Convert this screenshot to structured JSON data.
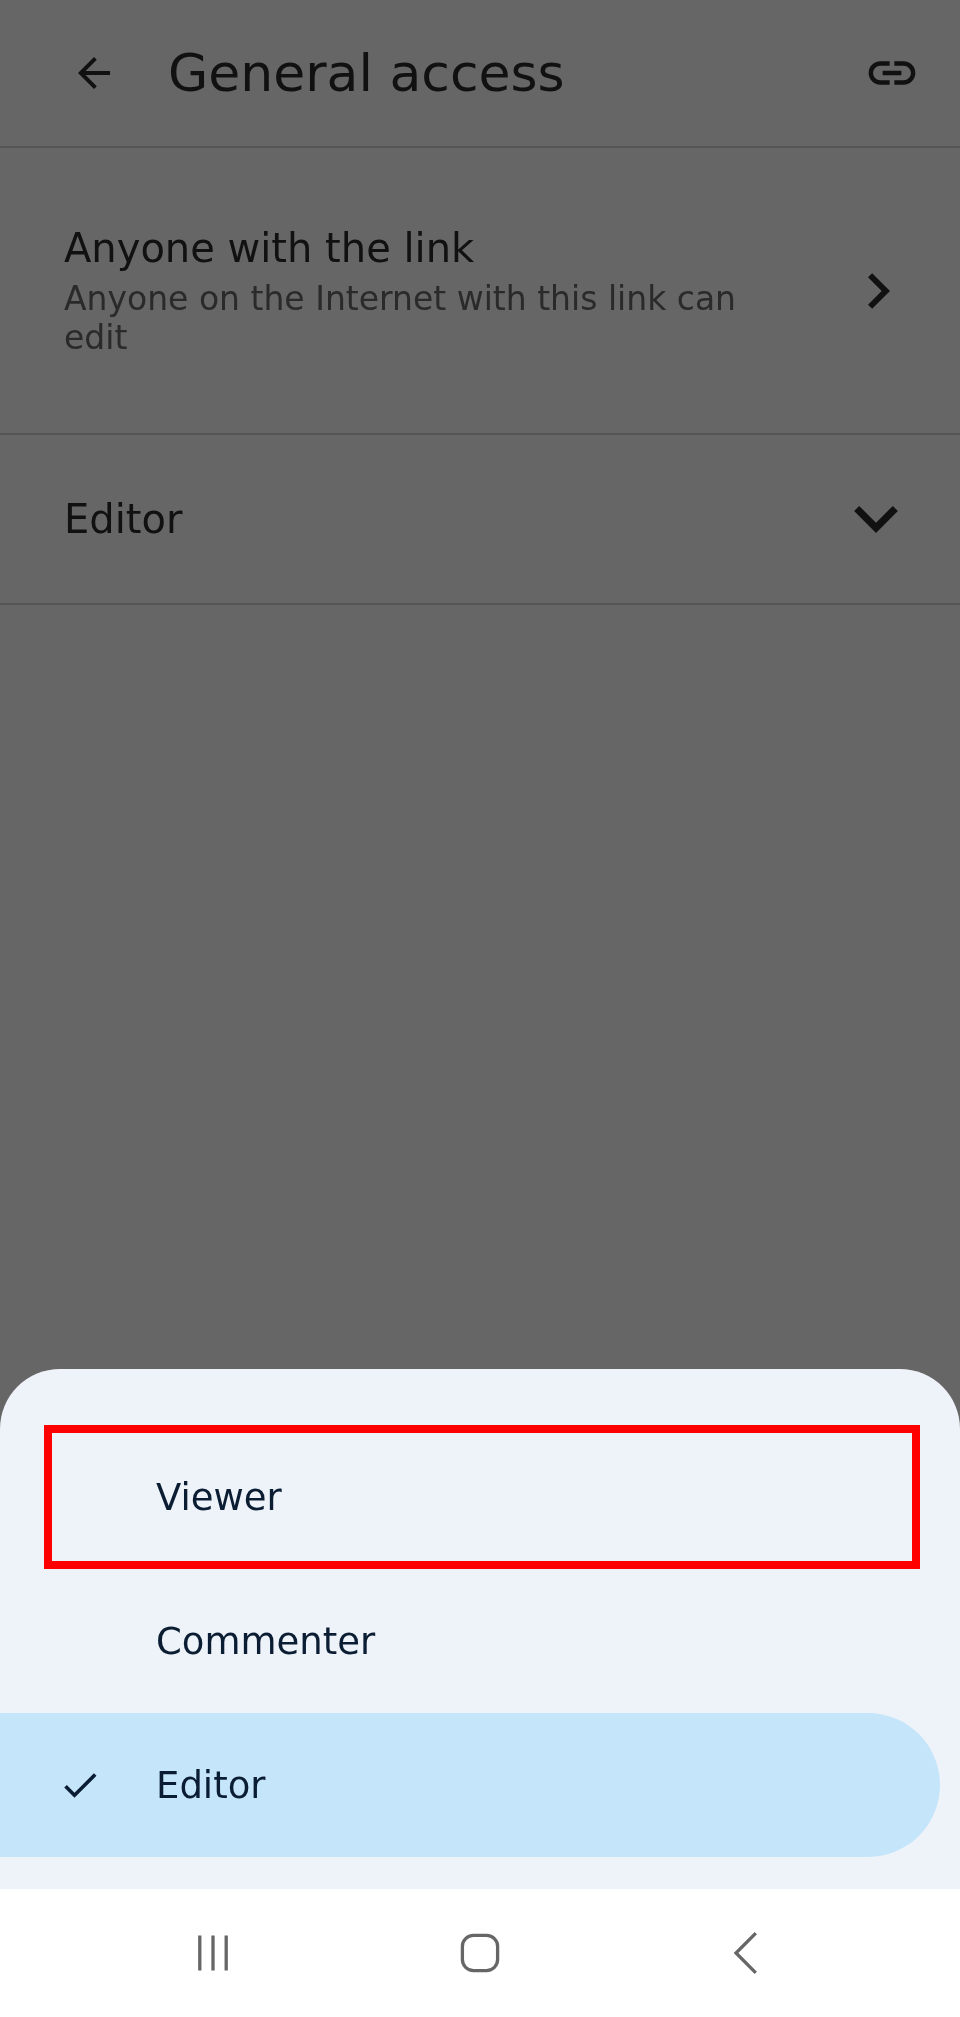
{
  "app_bar": {
    "title": "General access"
  },
  "access_row": {
    "title": "Anyone with the link",
    "subtitle": "Anyone on the Internet with this link can edit"
  },
  "role_row": {
    "label": "Editor"
  },
  "role_sheet": {
    "options": [
      {
        "label": "Viewer",
        "selected": false,
        "highlighted": true
      },
      {
        "label": "Commenter",
        "selected": false,
        "highlighted": false
      },
      {
        "label": "Editor",
        "selected": true,
        "highlighted": false
      }
    ]
  }
}
